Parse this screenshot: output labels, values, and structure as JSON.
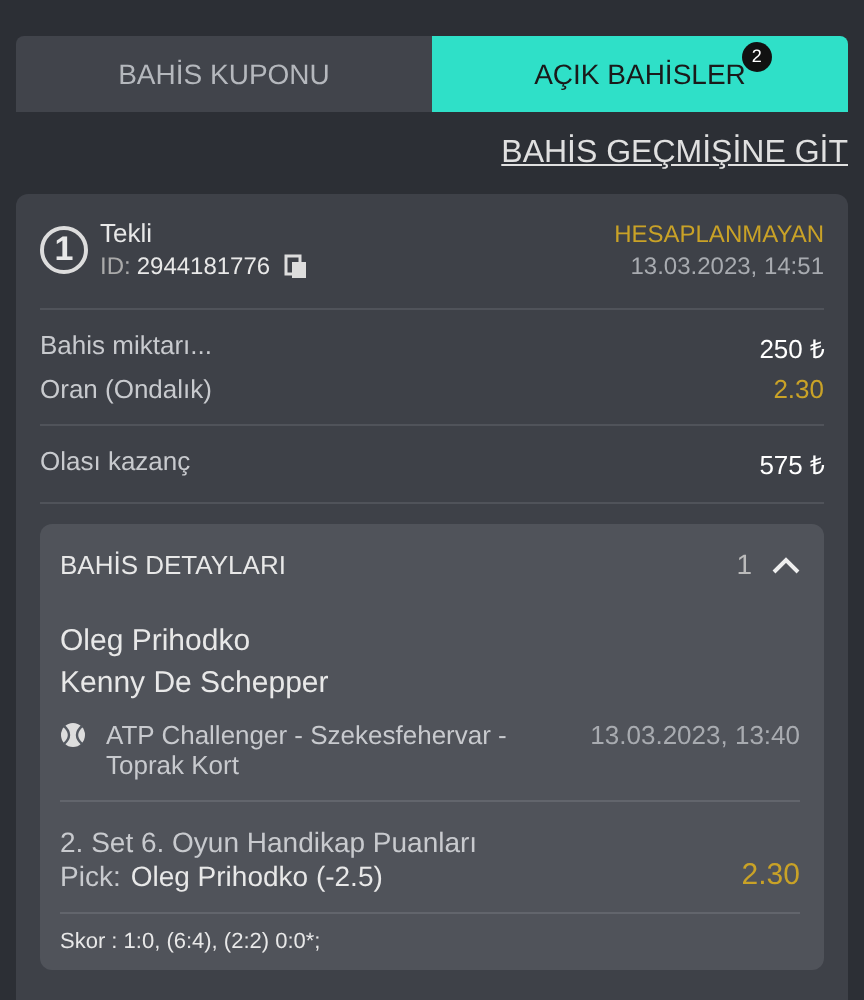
{
  "tabs": [
    {
      "label": "BAHİS KUPONU",
      "selected": false
    },
    {
      "label": "AÇIK BAHİSLER",
      "selected": true,
      "badge": "2"
    }
  ],
  "history_link": "BAHİS GEÇMİŞİNE GİT",
  "bet": {
    "number": "1",
    "type": "Tekli",
    "id_label": "ID:",
    "id": "2944181776",
    "status": "HESAPLANMAYAN",
    "datetime": "13.03.2023, 14:51",
    "stake_label": "Bahis miktarı...",
    "stake": "250 ₺",
    "odds_label": "Oran (Ondalık)",
    "odds": "2.30",
    "win_label": "Olası kazanç",
    "win": "575 ₺",
    "details": {
      "title": "BAHİS DETAYLARI",
      "count": "1",
      "expanded": true,
      "home": "Oleg Prihodko",
      "away": "Kenny De Schepper",
      "league": "ATP Challenger - Szekesfehervar - Toprak Kort",
      "match_time": "13.03.2023, 13:40",
      "market": "2. Set 6. Oyun Handikap Puanları",
      "pick_label": "Pick:",
      "pick": "Oleg Prihodko (-2.5)",
      "pick_odds": "2.30",
      "score": "Skor : 1:0, (6:4), (2:2) 0:0*;"
    }
  }
}
